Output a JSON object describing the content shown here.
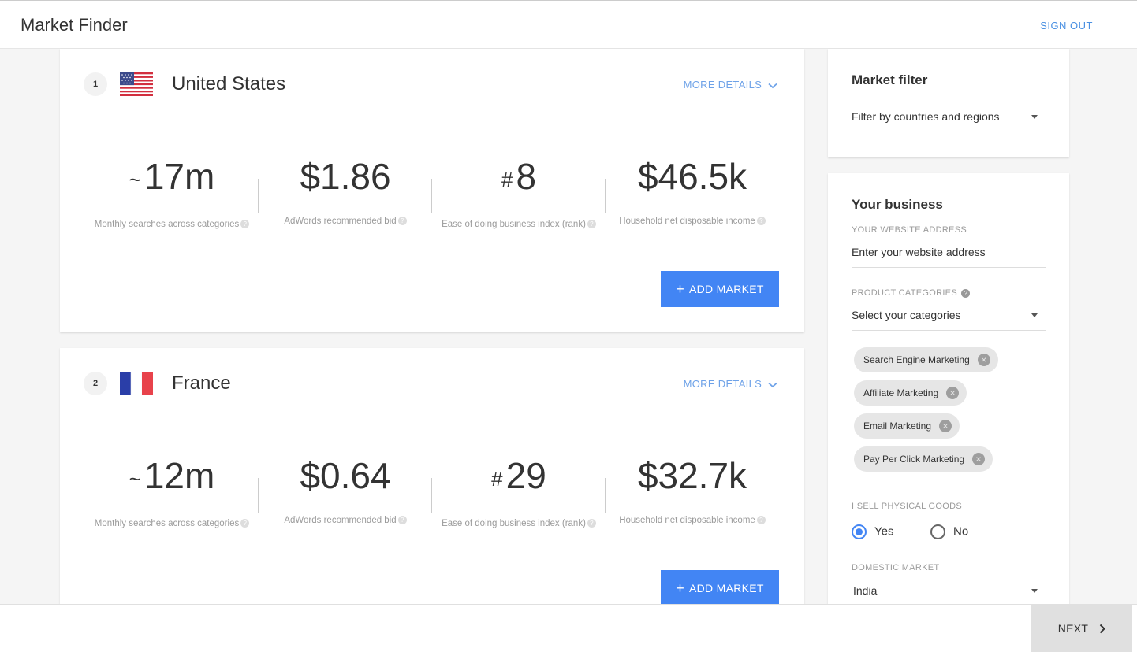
{
  "header": {
    "title": "Market Finder",
    "signout": "SIGN OUT"
  },
  "markets": [
    {
      "rank": "1",
      "country": "United States",
      "more": "MORE DETAILS",
      "searches": "17m",
      "searches_prefix": "~",
      "searches_label": "Monthly searches across categories",
      "bid": "$1.86",
      "bid_label": "AdWords recommended bid",
      "ease": "8",
      "ease_prefix": "#",
      "ease_label": "Ease of doing business index (rank)",
      "income": "$46.5k",
      "income_label": "Household net disposable income",
      "add": "ADD MARKET"
    },
    {
      "rank": "2",
      "country": "France",
      "more": "MORE DETAILS",
      "searches": "12m",
      "searches_prefix": "~",
      "searches_label": "Monthly searches across categories",
      "bid": "$0.64",
      "bid_label": "AdWords recommended bid",
      "ease": "29",
      "ease_prefix": "#",
      "ease_label": "Ease of doing business index (rank)",
      "income": "$32.7k",
      "income_label": "Household net disposable income",
      "add": "ADD MARKET"
    }
  ],
  "filter": {
    "title": "Market filter",
    "dropdown": "Filter by countries and regions"
  },
  "business": {
    "title": "Your business",
    "website_label": "YOUR WEBSITE ADDRESS",
    "website_placeholder": "Enter your website address",
    "categories_label": "PRODUCT CATEGORIES",
    "categories_dropdown": "Select your categories",
    "chips": [
      "Search Engine Marketing",
      "Affiliate Marketing",
      "Email Marketing",
      "Pay Per Click Marketing"
    ],
    "physical_label": "I SELL PHYSICAL GOODS",
    "yes": "Yes",
    "no": "No",
    "domestic_label": "DOMESTIC MARKET",
    "domestic_value": "India"
  },
  "footer": {
    "next": "NEXT"
  },
  "colors": {
    "accent": "#4285f4",
    "link": "#4a90e2"
  }
}
